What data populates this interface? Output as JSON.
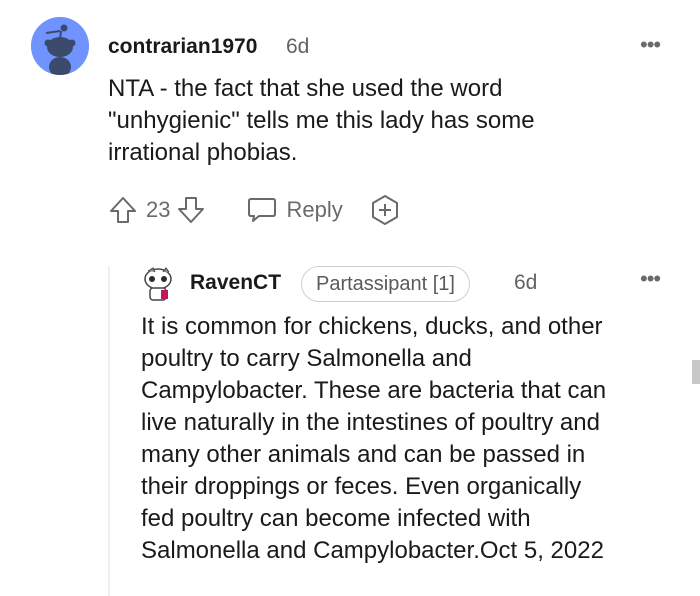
{
  "comment": {
    "username": "contrarian1970",
    "time": "6d",
    "text_lines": [
      "NTA - the fact that she used the word",
      "\"unhygienic\" tells me this lady has some",
      "irrational phobias."
    ],
    "vote_count": "23",
    "reply_label": "Reply",
    "more_icon": "more-dots-icon"
  },
  "reply": {
    "username": "RavenCT",
    "flair": "Partassipant [1]",
    "time": "6d",
    "text_lines": [
      "It is common for chickens, ducks, and other",
      "poultry to carry Salmonella and",
      "Campylobacter. These are bacteria that can",
      "live naturally in the intestines of poultry and",
      "many other animals and can be passed in",
      "their droppings or feces. Even organically",
      "fed poultry can become infected with",
      "Salmonella and Campylobacter.Oct 5, 2022"
    ],
    "more_icon": "more-dots-icon"
  },
  "colors": {
    "avatar_bg": "#7193ff",
    "text": "#1a1a1b",
    "muted": "#6a6a6a"
  }
}
